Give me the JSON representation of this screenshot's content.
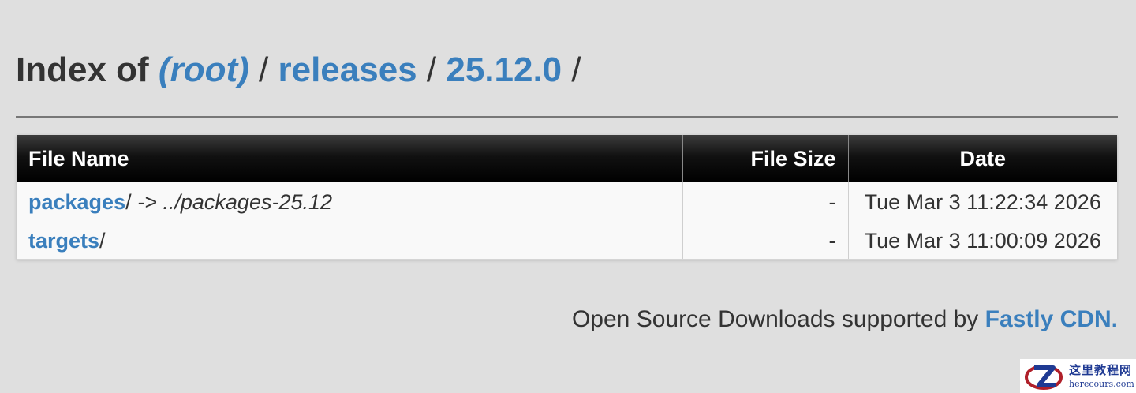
{
  "heading": {
    "prefix": "Index of",
    "root": "(root)",
    "sep1": "/",
    "releases": "releases",
    "sep2": "/",
    "version": "25.12.0",
    "sep3": "/"
  },
  "table": {
    "columns": [
      "File Name",
      "File Size",
      "Date"
    ],
    "rows": [
      {
        "name": "packages",
        "slash": "/",
        "symlink": " -> ../packages-25.12",
        "size": "-",
        "date": "Tue Mar 3 11:22:34 2026"
      },
      {
        "name": "targets",
        "slash": "/",
        "symlink": "",
        "size": "-",
        "date": "Tue Mar 3 11:00:09 2026"
      }
    ]
  },
  "footer": {
    "text": "Open Source Downloads supported by ",
    "link": "Fastly CDN."
  },
  "watermark": {
    "cn": "这里教程网",
    "en": "herecours.com",
    "icon": "z-logo-icon"
  },
  "colors": {
    "background": "#dfdfdf",
    "link": "#3a7fbd",
    "text": "#333333",
    "header_bg": "#000000"
  }
}
